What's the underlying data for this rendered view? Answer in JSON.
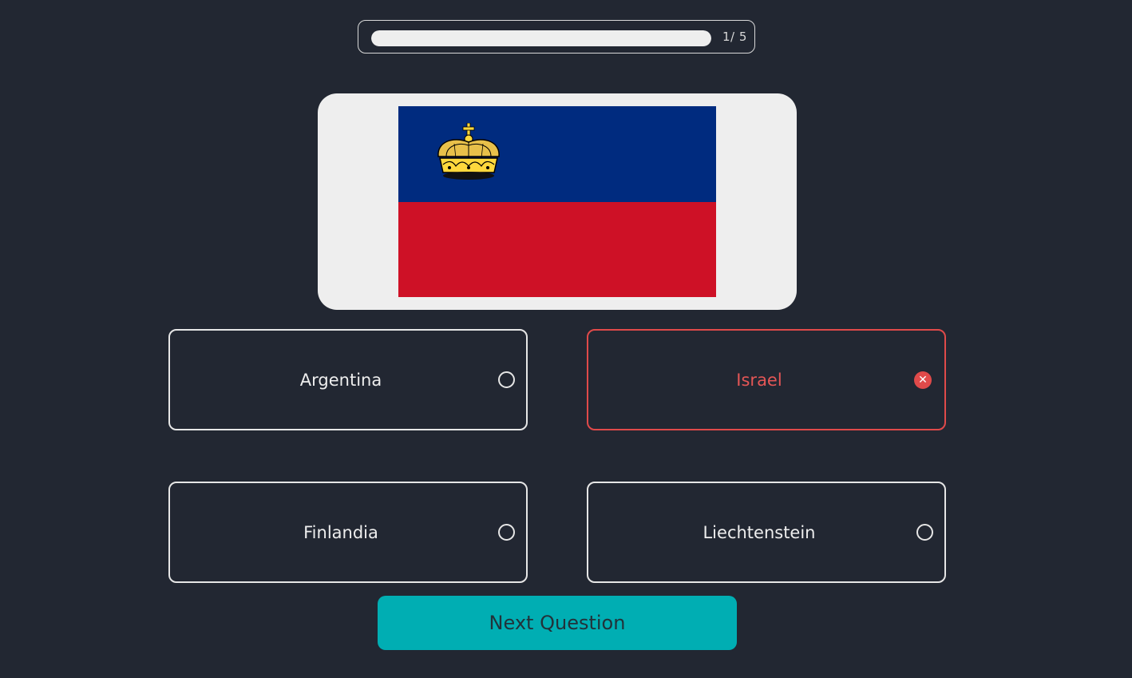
{
  "progress": {
    "current": 1,
    "total": 5,
    "fraction": 1.0,
    "label": "1/ 5"
  },
  "flag": {
    "icon": "liechtenstein-flag",
    "colors": {
      "blue": "#002B7F",
      "red": "#CE1126",
      "crown": "#FFD83D"
    }
  },
  "options": [
    {
      "label": "Argentina",
      "state": "unselected"
    },
    {
      "label": "Israel",
      "state": "wrong",
      "icon": "x-circle-icon"
    },
    {
      "label": "Finlandia",
      "state": "unselected"
    },
    {
      "label": "Liechtenstein",
      "state": "unselected"
    }
  ],
  "next_button": {
    "label": "Next Question"
  },
  "colors": {
    "background": "#222732",
    "accent": "#00AEB3",
    "wrong": "#E04A4A",
    "card": "#EEEEEE"
  }
}
